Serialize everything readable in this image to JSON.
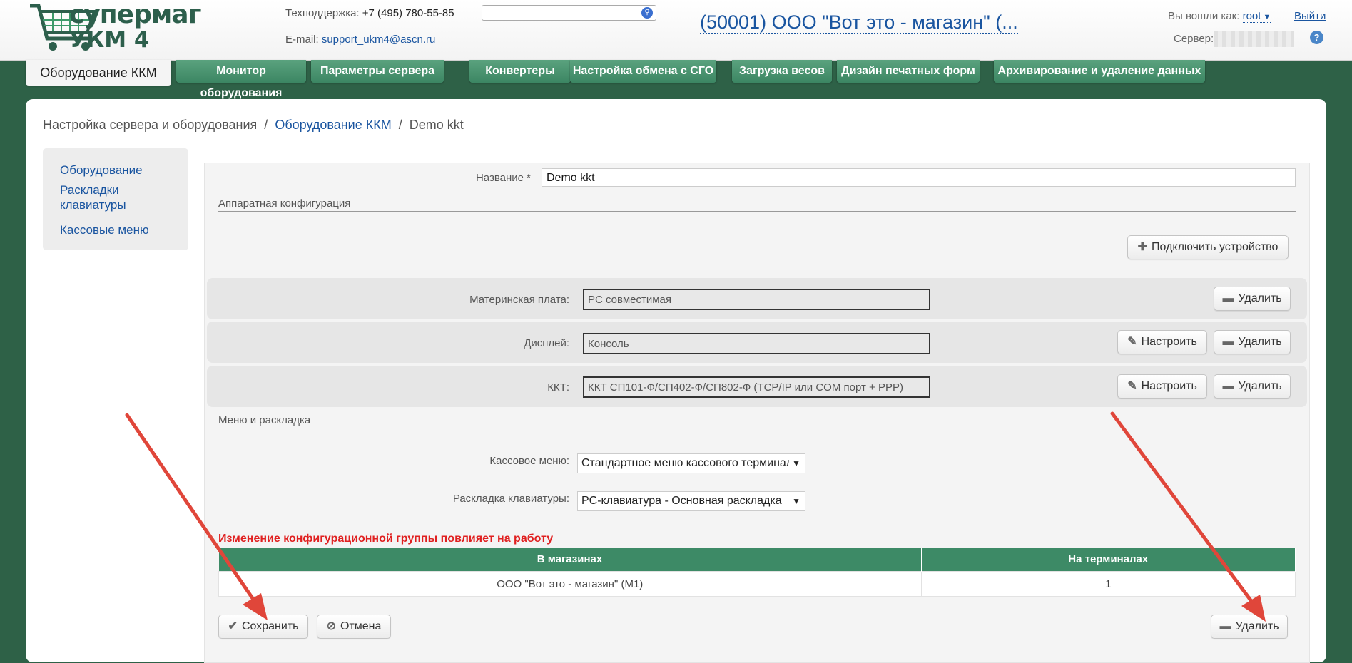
{
  "header": {
    "logo_line1": "супермаг",
    "logo_line2": "УКМ 4",
    "support_label": "Техподдержка:",
    "support_phone": "+7 (495) 780-55-85",
    "email_label": "E-mail:",
    "email": "support_ukm4@ascn.ru",
    "search_placeholder": "",
    "store_title": "(50001) ООО \"Вот это - магазин\" (...",
    "logged_in_label": "Вы вошли как:",
    "user": "root",
    "logout": "Выйти",
    "server_label": "Сервер:",
    "help": "?"
  },
  "tabs": [
    {
      "label": "Оборудование ККМ",
      "active": true
    },
    {
      "label": "Монитор оборудования"
    },
    {
      "label": "Параметры сервера"
    },
    {
      "label": "Конвертеры"
    },
    {
      "label": "Настройка обмена с СГО"
    },
    {
      "label": "Загрузка весов"
    },
    {
      "label": "Дизайн печатных форм"
    },
    {
      "label": "Архивирование и удаление данных"
    }
  ],
  "breadcrumb": {
    "root": "Настройка сервера и оборудования",
    "sep": "/",
    "link": "Оборудование ККМ",
    "current": "Demo kkt"
  },
  "sidenav": [
    {
      "label": "Оборудование"
    },
    {
      "label": "Раскладки клавиатуры"
    },
    {
      "label": "Кассовые меню"
    }
  ],
  "form": {
    "name_label": "Название *",
    "name_value": "Demo kkt",
    "hw_section": "Аппаратная конфигурация",
    "connect_button": "Подключить устройство",
    "devices": [
      {
        "label": "Материнская плата:",
        "value": "PC совместимая",
        "configure": false
      },
      {
        "label": "Дисплей:",
        "value": "Консоль",
        "configure": true
      },
      {
        "label": "ККТ:",
        "value": "ККТ СП101-Ф/СП402-Ф/СП802-Ф (TCP/IP или COM порт + PPP)",
        "configure": true
      }
    ],
    "configure_button": "Настроить",
    "delete_button": "Удалить",
    "menu_section": "Меню и раскладка",
    "cash_menu_label": "Кассовое меню:",
    "cash_menu_value": "Стандартное меню кассового терминала",
    "keyboard_label": "Раскладка клавиатуры:",
    "keyboard_value": "PC-клавиатура - Основная раскладка",
    "warning": "Изменение конфигурационной группы повлияет на работу",
    "table": {
      "headers": [
        "В магазинах",
        "На терминалах"
      ],
      "rows": [
        [
          "ООО \"Вот это - магазин\" (M1)",
          "1"
        ]
      ]
    },
    "save_button": "Сохранить",
    "cancel_button": "Отмена",
    "delete_group_button": "Удалить"
  },
  "colors": {
    "brand_green": "#3d8a66",
    "background": "#2e6147",
    "link": "#1a55a0",
    "warning": "#e02020",
    "arrow": "#e0463a"
  }
}
